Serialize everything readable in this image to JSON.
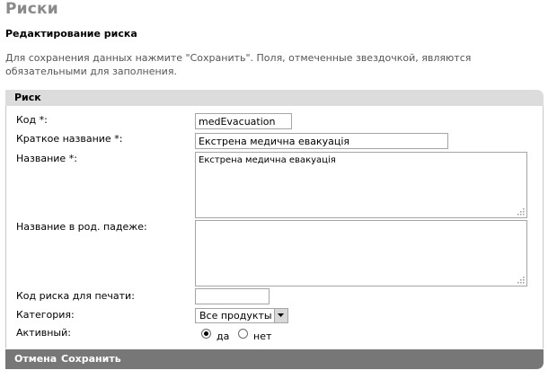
{
  "page": {
    "title": "Риски",
    "subtitle": "Редактирование риска",
    "instructions": "Для сохранения данных нажмите \"Сохранить\". Поля, отмеченные звездочкой, являются обязательными для заполнения."
  },
  "panel": {
    "header": "Риск"
  },
  "form": {
    "code": {
      "label": "Код *:",
      "value": "medEvacuation"
    },
    "short_name": {
      "label": "Краткое название *:",
      "value": "Екстрена медична евакуація"
    },
    "name": {
      "label": "Название *:",
      "value": "Екстрена медична евакуація"
    },
    "name_genitive": {
      "label": "Название в род. падеже:",
      "value": ""
    },
    "print_code": {
      "label": "Код риска для печати:",
      "value": ""
    },
    "category": {
      "label": "Категория:",
      "selected": "Все продукты"
    },
    "active": {
      "label": "Активный:",
      "yes_label": "да",
      "no_label": "нет",
      "selected": "yes"
    }
  },
  "footer": {
    "cancel_label": "Отмена",
    "save_label": "Сохранить"
  },
  "colors": {
    "header_bg": "#dcdcdc",
    "footer_bg": "#777777",
    "title_gray": "#8a8a8a"
  }
}
